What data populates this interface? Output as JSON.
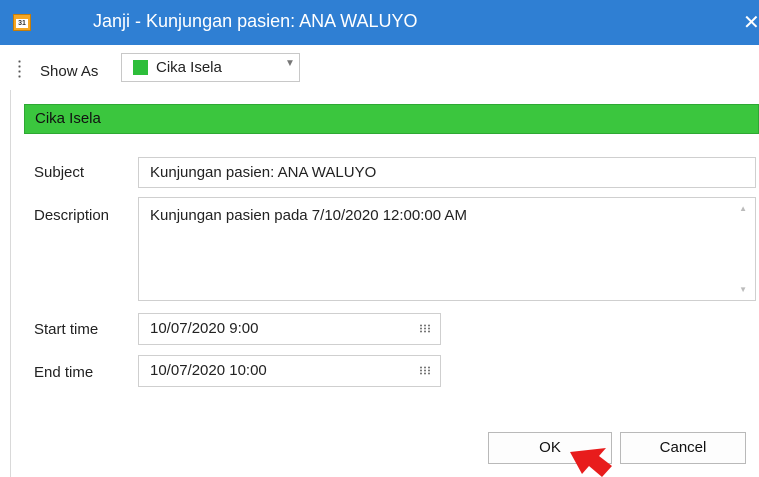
{
  "window": {
    "title": "Janji - Kunjungan pasien: ANA WALUYO",
    "icon_text": "31",
    "close_symbol": "✕"
  },
  "toolbar": {
    "show_as_label": "Show As",
    "show_as_value": "Cika Isela",
    "show_as_color": "#2dbe3a"
  },
  "category": {
    "label": "Cika Isela",
    "color": "#3bc63e"
  },
  "form": {
    "subject_label": "Subject",
    "subject_value": "Kunjungan pasien: ANA WALUYO",
    "description_label": "Description",
    "description_value": "Kunjungan pasien pada 7/10/2020 12:00:00 AM",
    "start_label": "Start time",
    "start_value": "10/07/2020 9:00",
    "end_label": "End time",
    "end_value": "10/07/2020 10:00"
  },
  "buttons": {
    "ok": "OK",
    "cancel": "Cancel"
  },
  "accent_colors": {
    "titlebar": "#2f7fd3",
    "cursor": "#e81c1c"
  }
}
